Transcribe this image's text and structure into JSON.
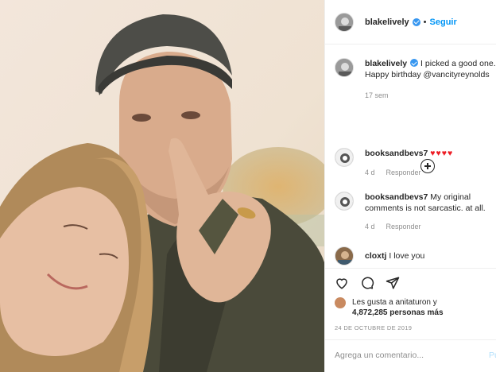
{
  "post": {
    "author": "blakelively",
    "follow_label": "Seguir",
    "dot": "•",
    "caption_line1": "I picked a good one.",
    "caption_line2": "Happy birthday @vancityreynolds",
    "caption_age": "17 sem"
  },
  "comments": [
    {
      "user": "booksandbevs7",
      "text": "",
      "hearts": "♥♥♥♥",
      "age": "4 d",
      "reply": "Responder"
    },
    {
      "user": "booksandbevs7",
      "text_line1": "My original",
      "text_line2": "comments is not sarcastic. at all.",
      "age": "4 d",
      "reply": "Responder"
    },
    {
      "user": "cloxtj",
      "text": "I love you"
    }
  ],
  "likes": {
    "line1": "Les gusta a anitaturon y",
    "line2": "4,872,285 personas más"
  },
  "date": "24 DE OCTUBRE DE 2019",
  "add_comment": {
    "placeholder": "Agrega un comentario...",
    "publish_label": "Pu"
  },
  "colors": {
    "accent": "#0095f6",
    "verified": "#3897f0",
    "hearts": "#ed1c24",
    "muted": "#8e8e8e"
  },
  "icons": [
    "verified-badge-icon",
    "add-circle-icon",
    "heart-icon",
    "comment-icon",
    "share-icon"
  ]
}
